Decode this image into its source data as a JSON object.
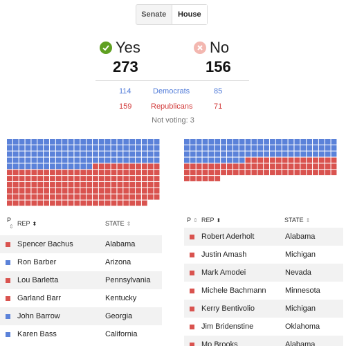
{
  "tabs": [
    {
      "label": "Senate",
      "active": false
    },
    {
      "label": "House",
      "active": true
    }
  ],
  "summary": {
    "yes_label": "Yes",
    "no_label": "No",
    "yes_total": "273",
    "no_total": "156",
    "democrats_label": "Democrats",
    "republicans_label": "Republicans",
    "yes_dem": "114",
    "no_dem": "85",
    "yes_rep": "159",
    "no_rep": "71",
    "not_voting": "Not voting: 3"
  },
  "colors": {
    "dem": "#5b82d9",
    "rep": "#d9534f",
    "yes": "#5fa021",
    "no": "#f3b7b0"
  },
  "grids": {
    "yes": {
      "dem": 114,
      "rep": 159
    },
    "no": {
      "dem": 85,
      "rep": 71
    }
  },
  "table_headers": {
    "party": "P",
    "rep": "REP",
    "state": "STATE"
  },
  "yes_table": [
    {
      "party": "R",
      "name": "Spencer Bachus",
      "state": "Alabama"
    },
    {
      "party": "D",
      "name": "Ron Barber",
      "state": "Arizona"
    },
    {
      "party": "R",
      "name": "Lou Barletta",
      "state": "Pennsylvania"
    },
    {
      "party": "R",
      "name": "Garland Barr",
      "state": "Kentucky"
    },
    {
      "party": "D",
      "name": "John Barrow",
      "state": "Georgia"
    },
    {
      "party": "D",
      "name": "Karen Bass",
      "state": "California"
    }
  ],
  "no_table": [
    {
      "party": "R",
      "name": "Robert Aderholt",
      "state": "Alabama"
    },
    {
      "party": "R",
      "name": "Justin Amash",
      "state": "Michigan"
    },
    {
      "party": "R",
      "name": "Mark Amodei",
      "state": "Nevada"
    },
    {
      "party": "R",
      "name": "Michele Bachmann",
      "state": "Minnesota"
    },
    {
      "party": "R",
      "name": "Kerry Bentivolio",
      "state": "Michigan"
    },
    {
      "party": "R",
      "name": "Jim Bridenstine",
      "state": "Oklahoma"
    },
    {
      "party": "R",
      "name": "Mo Brooks",
      "state": "Alabama"
    }
  ]
}
